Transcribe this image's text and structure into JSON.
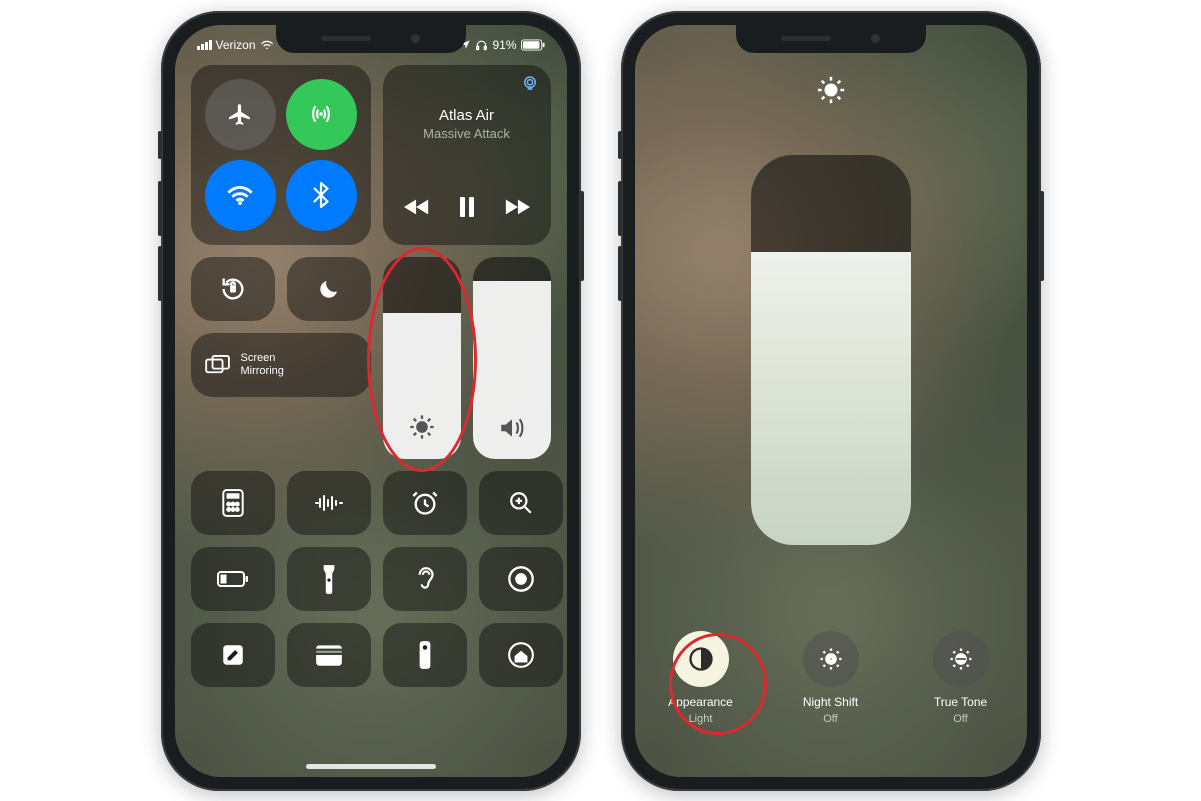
{
  "status": {
    "carrier": "Verizon",
    "battery_pct": "91%"
  },
  "media": {
    "track": "Atlas Air",
    "artist": "Massive Attack"
  },
  "mirroring": {
    "line1": "Screen",
    "line2": "Mirroring"
  },
  "brightness": {
    "level_pct": 72,
    "large_level_pct": 75
  },
  "volume": {
    "level_pct": 88
  },
  "options": {
    "appearance": {
      "label": "Appearance",
      "value": "Light"
    },
    "night_shift": {
      "label": "Night Shift",
      "value": "Off"
    },
    "true_tone": {
      "label": "True Tone",
      "value": "Off"
    }
  },
  "icons": {
    "airplane": "airplane",
    "cellular": "cellular-antenna",
    "wifi": "wifi",
    "bluetooth": "bluetooth",
    "lock_rotation": "rotation-lock",
    "dnd": "moon",
    "mirror": "screen-mirroring",
    "brightness": "sun",
    "volume": "speaker",
    "row_tiles": [
      "calculator",
      "voice-memos",
      "alarm",
      "magnifier",
      "low-power",
      "flashlight",
      "hearing",
      "screen-record",
      "notes",
      "wallet",
      "remote",
      "home"
    ]
  }
}
